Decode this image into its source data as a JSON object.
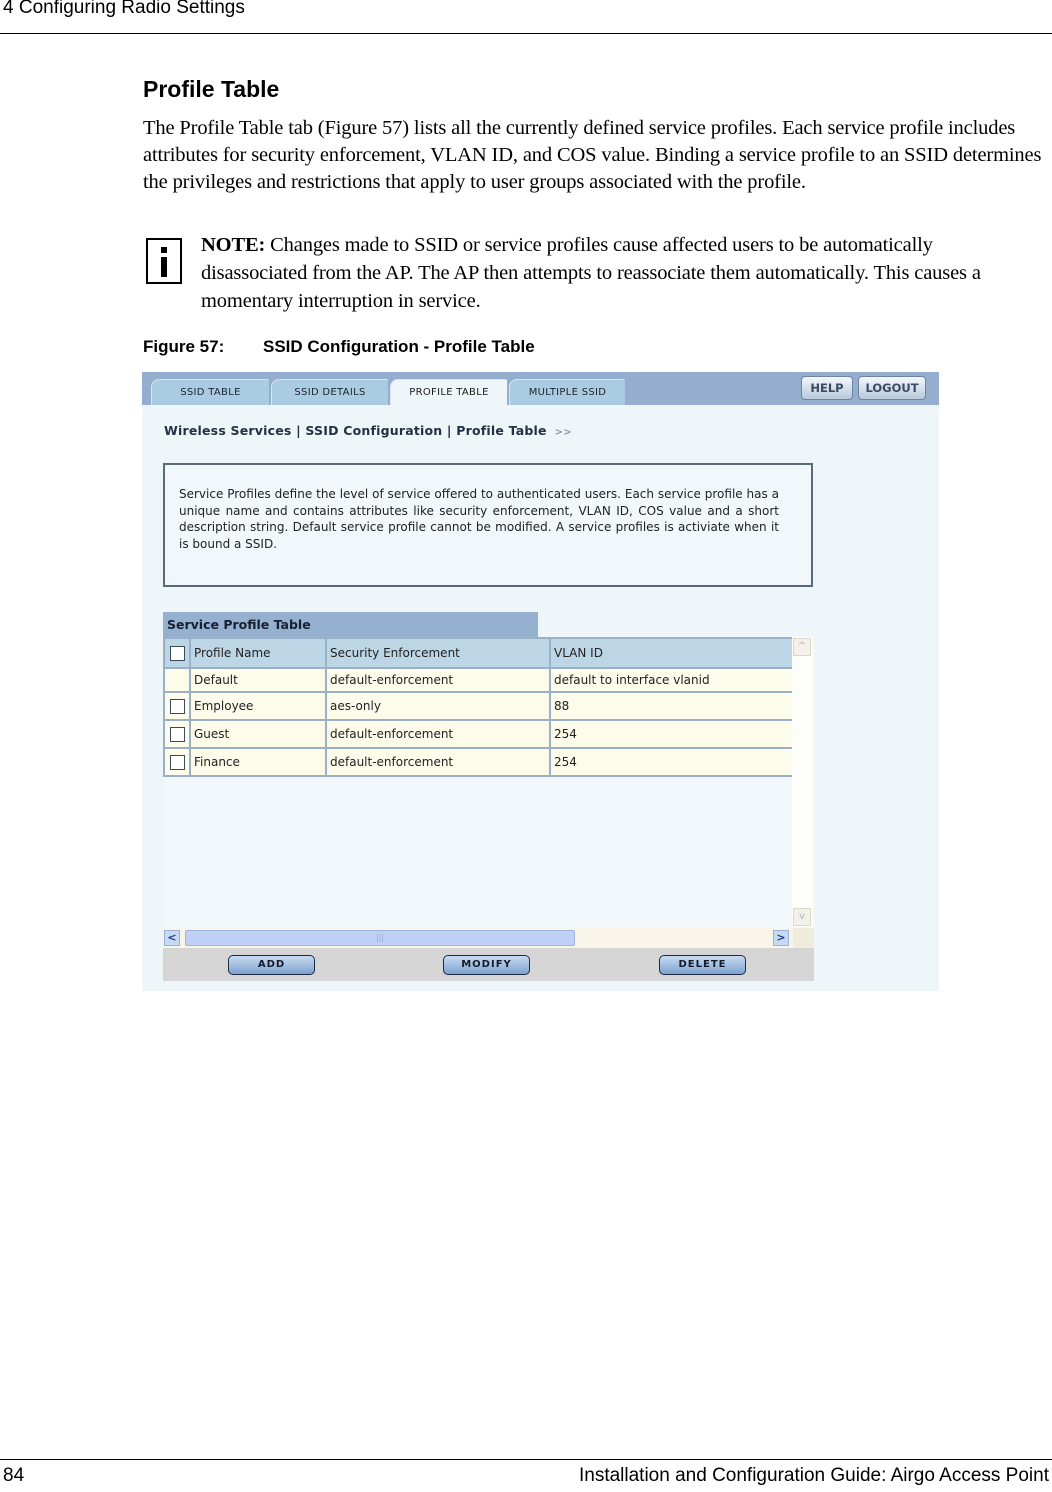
{
  "page": {
    "running_header": "4  Configuring Radio Settings",
    "section_title": "Profile Table",
    "body_paragraph": "The Profile Table tab (Figure 57) lists all the currently defined service profiles. Each service profile includes attributes for security enforcement, VLAN ID, and COS value. Binding a service profile to an SSID determines the privileges and restrictions that apply to user groups associated with the profile.",
    "note": {
      "icon": "info-icon",
      "label": "NOTE:",
      "text": " Changes made to SSID or service profiles cause affected users to be automatically disassociated from the AP. The AP then attempts to reassociate them automatically. This causes a momentary interruption in service."
    },
    "figure_caption": {
      "number": "Figure 57:",
      "title": "SSID Configuration - Profile Table"
    },
    "footer": {
      "page_number": "84",
      "guide_title": "Installation and Configuration Guide: Airgo Access Point"
    }
  },
  "ui": {
    "tabs": [
      {
        "label": "SSID TABLE",
        "active": false
      },
      {
        "label": "SSID DETAILS",
        "active": false
      },
      {
        "label": "PROFILE TABLE",
        "active": true
      },
      {
        "label": "MULTIPLE SSID",
        "active": false
      }
    ],
    "header_buttons": {
      "help": "HELP",
      "logout": "LOGOUT"
    },
    "breadcrumb": "Wireless Services | SSID Configuration | Profile Table",
    "breadcrumb_arrows": ">>",
    "description": "Service Profiles define the level of service offered to authenticated users. Each service profile has a unique name and contains attributes like security enforcement, VLAN ID, COS value and a short description string. Default service profile cannot be modified. A service profiles is activiate when it is bound a SSID.",
    "table": {
      "title": "Service Profile Table",
      "columns": [
        "Profile Name",
        "Security Enforcement",
        "VLAN ID"
      ],
      "rows": [
        {
          "name": "Default",
          "security": "default-enforcement",
          "vlan": "default to interface vlanid",
          "checkbox": false
        },
        {
          "name": "Employee",
          "security": "aes-only",
          "vlan": "88",
          "checkbox": true
        },
        {
          "name": "Guest",
          "security": "default-enforcement",
          "vlan": "254",
          "checkbox": true
        },
        {
          "name": "Finance",
          "security": "default-enforcement",
          "vlan": "254",
          "checkbox": true
        }
      ]
    },
    "scrollbar": {
      "up": "^",
      "down": "v",
      "left": "<",
      "right": ">",
      "grip": "|||"
    },
    "actions": {
      "add": "ADD",
      "modify": "MODIFY",
      "delete": "DELETE"
    },
    "colors": {
      "tabbar": "#95aed0",
      "tab": "#aacbe2",
      "panel": "#eff6f9",
      "table_header": "#bcd6e6",
      "row": "#fdfbea",
      "button_bar": "#d5d5d5"
    }
  }
}
